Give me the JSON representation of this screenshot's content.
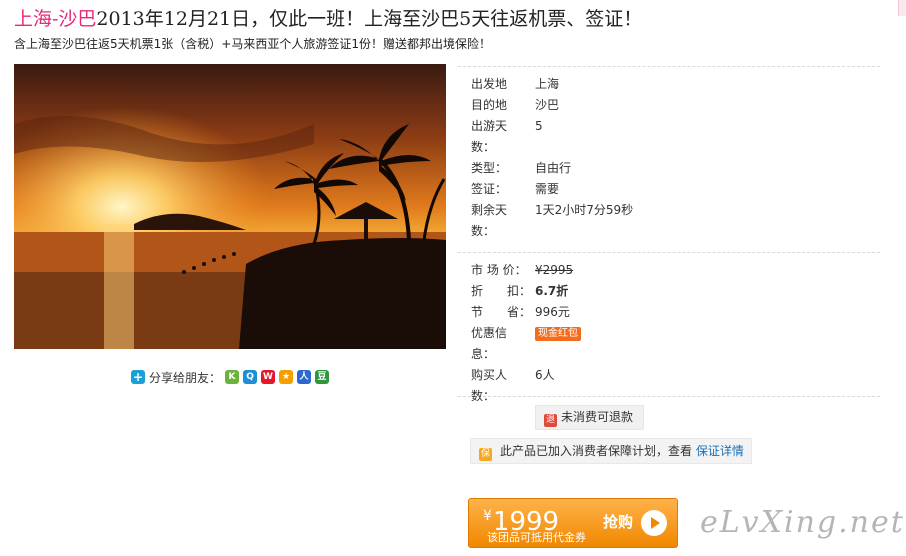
{
  "title": {
    "destination": "上海-沙巴",
    "rest": "2013年12月21日，仅此一班！上海至沙巴5天往返机票、签证！"
  },
  "subtitle": "含上海至沙巴往返5天机票1张（含税）+马来西亚个人旅游签证1份！赠送都邦出境保险！",
  "share": {
    "label": "分享给朋友：",
    "icons": [
      "kaixin-icon",
      "qzone-icon",
      "weibo-icon",
      "star-icon",
      "renren-icon",
      "douban-icon"
    ]
  },
  "details": [
    {
      "label": "出发地",
      "value": "上海"
    },
    {
      "label": "目的地",
      "value": "沙巴"
    },
    {
      "label": "出游天",
      "label2": "数：",
      "value": "5"
    },
    {
      "label": "类型：",
      "value": "自由行"
    },
    {
      "label": "签证：",
      "value": "需要"
    },
    {
      "label": "剩余天",
      "label2": "数：",
      "value": "1天2小时7分59秒"
    }
  ],
  "pricing": {
    "market_label": "市 场 价：",
    "market_value": "¥2995",
    "discount_label": "折　　扣：",
    "discount_value": "6.7折",
    "save_label": "节　　省：",
    "save_value": "996元",
    "promo_label": "优惠信",
    "promo_label2": "息：",
    "promo_tag": "现金红包",
    "buyers_label": "购买人",
    "buyers_label2": "数：",
    "buyers_value": "6人"
  },
  "refund": {
    "icon_text": "退",
    "label": "未消费可退款"
  },
  "guarantee": {
    "icon_text": "保",
    "text": "此产品已加入消费者保障计划，查看",
    "link": "保证详情"
  },
  "buy": {
    "currency": "¥",
    "price": "1999",
    "note": "该团品可抵用代金券",
    "action": "抢购"
  },
  "watermark": "eLvXing.net",
  "colors": {
    "accent": "#e6287a",
    "buy_button": "#f08800",
    "link": "#1a6fb8"
  }
}
